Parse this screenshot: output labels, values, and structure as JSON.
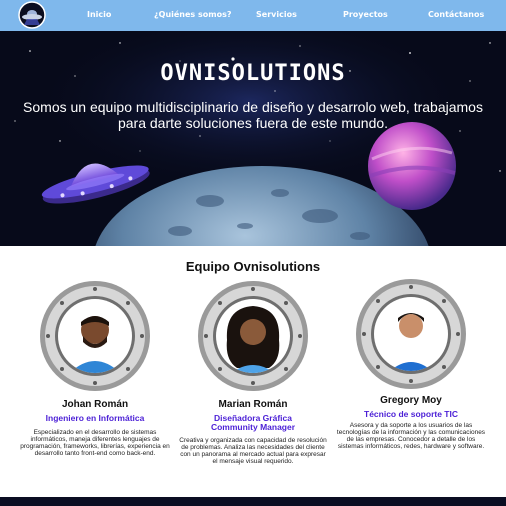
{
  "nav": {
    "logo_icon": "ufo-logo-icon",
    "items": [
      {
        "label": "Inicio"
      },
      {
        "label": "¿Quiénes somos?"
      },
      {
        "label": "Servicios"
      },
      {
        "label": "Proyectos"
      },
      {
        "label": "Contáctanos"
      }
    ]
  },
  "hero": {
    "title": "OVNISOLUTIONS",
    "subtitle": "Somos un equipo multidisciplinario de diseño y desarrolo web, trabajamos para darte soluciones fuera de este mundo."
  },
  "team": {
    "title": "Equipo Ovnisolutions",
    "members": [
      {
        "name": "Johan Román",
        "role": "Ingeniero en Informática",
        "description": "Especializado en el desarrollo de sistemas informáticos, maneja diferentes lenguajes de programación, frameworks, librerías, experiencia en desarrollo tanto front-end como back-end."
      },
      {
        "name": "Marian Román",
        "role": "Diseñadora Gráfica\nCommunity Manager",
        "description": "Creativa y organizada con capacidad de resolución de problemas. Analiza las necesidades del cliente con un panorama al mercado actual para expresar el mensaje visual requerido."
      },
      {
        "name": "Gregory Moy",
        "role": "Técnico de soporte TIC",
        "description": "Asesora y da soporte a los usuarios de las tecnologías de la información y las comunicaciones de las empresas. Conocedor a detalle de los sistemas informáticos, redes, hardware y software."
      }
    ]
  },
  "colors": {
    "nav_bg": "#7fb8ec",
    "role_text": "#4b1fd6",
    "hero_bg": "#070a1a"
  }
}
